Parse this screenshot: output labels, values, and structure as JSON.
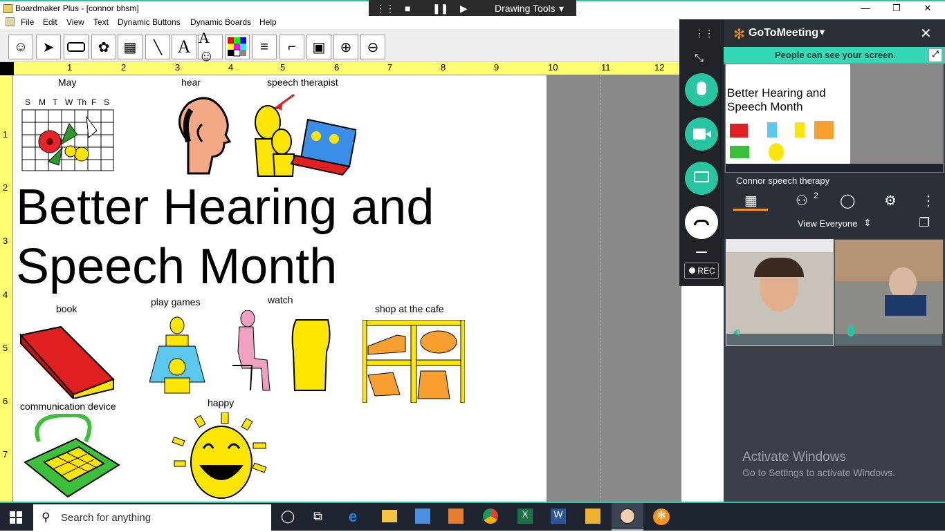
{
  "window": {
    "title": "Boardmaker Plus - [connor bhsm]"
  },
  "drawing_tools": {
    "label": "Drawing Tools"
  },
  "menu": [
    "File",
    "Edit",
    "View",
    "Text",
    "Dynamic Buttons",
    "Dynamic Boards",
    "Help"
  ],
  "toolbar": [
    "face-tool",
    "pointer-tool",
    "rectangle-tool",
    "freeform-tool",
    "button-grid-tool",
    "line-tool",
    "text-tool",
    "symbol-text-tool",
    "color-tool",
    "line-thickness-tool",
    "corner-tool",
    "border-tool",
    "zoom-in-tool",
    "zoom-out-tool"
  ],
  "ruler": {
    "h": [
      "1",
      "2",
      "3",
      "4",
      "5",
      "6",
      "7",
      "8",
      "9",
      "10",
      "11",
      "12"
    ],
    "v": [
      "1",
      "2",
      "3",
      "4",
      "5",
      "6",
      "7"
    ]
  },
  "board": {
    "calendar_days": [
      "S",
      "M",
      "T",
      "W",
      "Th",
      "F",
      "S"
    ],
    "labels": {
      "may": "May",
      "hear": "hear",
      "speech_therapist": "speech therapist",
      "title_line1": "Better Hearing and",
      "title_line2": "Speech Month",
      "book": "book",
      "play_games": "play games",
      "watch": "watch",
      "shop": "shop at the cafe",
      "comm_device": "communication device",
      "happy": "happy"
    }
  },
  "goto": {
    "brand": "GoToMeeting",
    "shared_banner": "People can see your screen.",
    "meeting_name": "Connor speech therapy",
    "attendee_count": "2",
    "view_mode": "View Everyone",
    "rec": "REC",
    "activate_title": "Activate Windows",
    "activate_sub": "Go to Settings to activate Windows."
  },
  "taskbar": {
    "search_placeholder": "Search for anything"
  },
  "colors": {
    "accent": "#2ec4a2",
    "ruler": "#ffff70",
    "teal": "#27c4a0"
  }
}
